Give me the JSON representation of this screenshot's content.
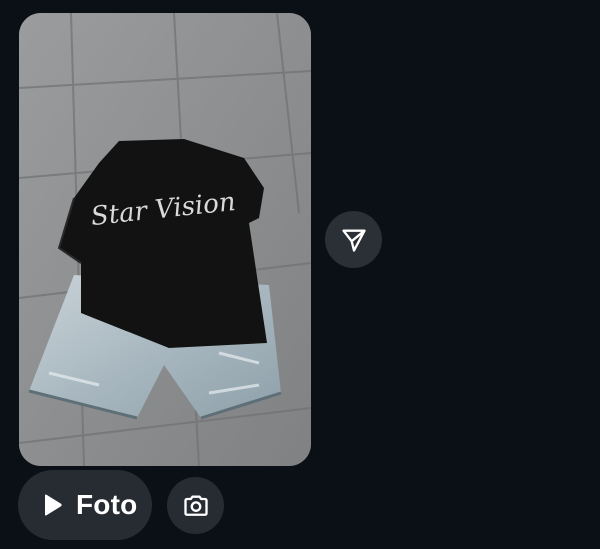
{
  "message": {
    "photo": {
      "description_icon": "photo-image",
      "shirt_text": "Star Vision"
    },
    "send_icon": "send-icon"
  },
  "composer": {
    "foto_label": "Foto",
    "foto_icon": "play-icon",
    "camera_icon": "camera-icon"
  },
  "colors": {
    "background": "#0b0f16",
    "button_bg": "#272b32",
    "send_bg": "#2b2f36",
    "text": "#ffffff"
  }
}
